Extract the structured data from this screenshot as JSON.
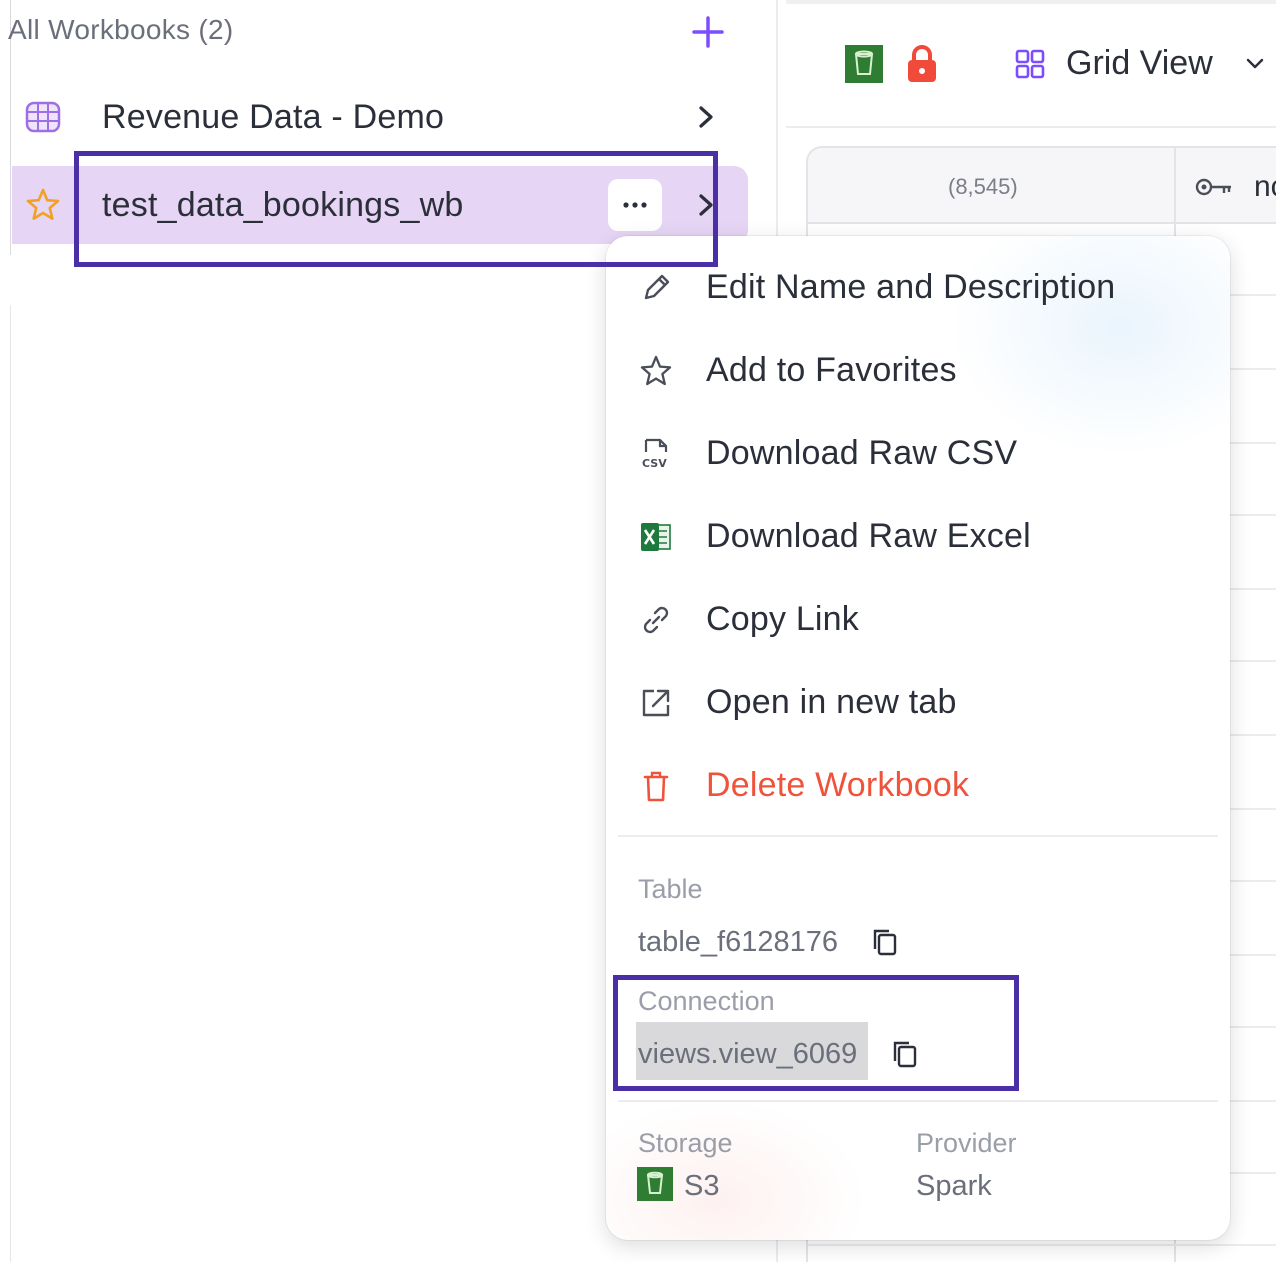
{
  "sidebar": {
    "header": "All Workbooks  (2)",
    "workbooks": [
      {
        "label": "Revenue Data - Demo",
        "icon": "table-grid-icon"
      },
      {
        "label": "test_data_bookings_wb",
        "icon": "star-icon",
        "selected": true
      }
    ]
  },
  "toolbar": {
    "view_label": "Grid View"
  },
  "table": {
    "row_count": "(8,545)",
    "column_name_partial": "nc"
  },
  "context_menu": {
    "items": [
      {
        "label": "Edit Name and Description",
        "icon": "pencil-icon"
      },
      {
        "label": "Add to Favorites",
        "icon": "star-outline-icon"
      },
      {
        "label": "Download Raw CSV",
        "icon": "csv-file-icon"
      },
      {
        "label": "Download Raw Excel",
        "icon": "excel-icon"
      },
      {
        "label": "Copy Link",
        "icon": "link-icon"
      },
      {
        "label": "Open in new tab",
        "icon": "external-link-icon"
      },
      {
        "label": "Delete Workbook",
        "icon": "trash-icon",
        "danger": true
      }
    ],
    "info": {
      "table_label": "Table",
      "table_value": "table_f6128176",
      "connection_label": "Connection",
      "connection_value": "views.view_6069",
      "storage_label": "Storage",
      "storage_value": "S3",
      "provider_label": "Provider",
      "provider_value": "Spark"
    }
  },
  "colors": {
    "accent": "#7c4dff",
    "highlight_border": "#4b2fa6",
    "selected_row": "#e6d5f5",
    "danger": "#f0533c",
    "s3_green": "#2e7d32",
    "lock_red": "#f04a3a"
  }
}
